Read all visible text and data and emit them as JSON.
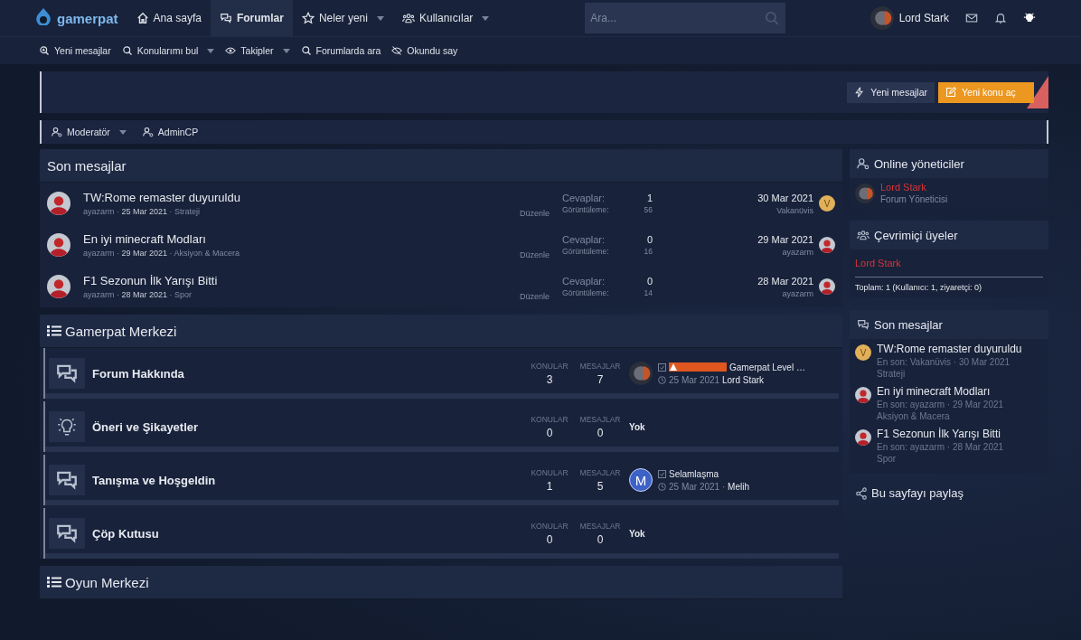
{
  "logo": {
    "text": "gamerpat"
  },
  "nav": [
    {
      "label": "Ana sayfa",
      "selected": false,
      "dropdown": false
    },
    {
      "label": "Forumlar",
      "selected": true,
      "dropdown": false
    },
    {
      "label": "Neler yeni",
      "selected": false,
      "dropdown": true
    },
    {
      "label": "Kullanıcılar",
      "selected": false,
      "dropdown": true
    }
  ],
  "search": {
    "placeholder": "Ara..."
  },
  "user": {
    "name": "Lord Stark"
  },
  "subnav": [
    {
      "label": "Yeni mesajlar",
      "dropdown": false
    },
    {
      "label": "Konularımı bul",
      "dropdown": true
    },
    {
      "label": "Takipler",
      "dropdown": true
    },
    {
      "label": "Forumlarda ara",
      "dropdown": false
    },
    {
      "label": "Okundu say",
      "dropdown": false
    }
  ],
  "actions": [
    {
      "label": "Yeni mesajlar",
      "kind": "secondary"
    },
    {
      "label": "Yeni konu aç",
      "kind": "primary"
    }
  ],
  "staff_bar": [
    {
      "label": "Moderatör",
      "dropdown": true
    },
    {
      "label": "AdminCP",
      "dropdown": false
    }
  ],
  "recent": {
    "title": "Son mesajlar",
    "threads": [
      {
        "title": "TW:Rome remaster duyuruldu",
        "meta": "ayazarm · **25 Mar 2021** · Strateji",
        "edit": "Düzenle",
        "replies_label": "Cevaplar:",
        "replies": "1",
        "views_label": "Görüntüleme:",
        "views": "56",
        "last_date": "30 Mar 2021",
        "last_user": "Vakanüvis",
        "last_avatar": "V"
      },
      {
        "title": "En iyi minecraft Modları",
        "meta": "ayazarm · **29 Mar 2021** · Aksiyon & Macera",
        "edit": "Düzenle",
        "replies_label": "Cevaplar:",
        "replies": "0",
        "views_label": "Görüntüleme:",
        "views": "16",
        "last_date": "29 Mar 2021",
        "last_user": "ayazarm"
      },
      {
        "title": "F1 Sezonun İlk Yarışı Bitti",
        "meta": "ayazarm · **28 Mar 2021** · Spor",
        "edit": "Düzenle",
        "replies_label": "Cevaplar:",
        "replies": "0",
        "views_label": "Görüntüleme:",
        "views": "14",
        "last_date": "28 Mar 2021",
        "last_user": "ayazarm"
      }
    ]
  },
  "categories": [
    {
      "title": "Gamerpat Merkezi",
      "forums": [
        {
          "name": "Forum Hakkında",
          "kind": "discussion",
          "topics_label": "KONULAR",
          "topics": "3",
          "posts_label": "MESAJLAR",
          "posts": "7",
          "last": {
            "kind": "post",
            "prefix": true,
            "title": "Gamerpat Level …",
            "meta": "25 Mar 2021 **Lord Stark**"
          }
        },
        {
          "name": "Öneri ve Şikayetler",
          "kind": "suggestion",
          "topics_label": "KONULAR",
          "topics": "0",
          "posts_label": "MESAJLAR",
          "posts": "0",
          "last": {
            "kind": "none",
            "text": "Yok"
          }
        },
        {
          "name": "Tanışma ve Hoşgeldin",
          "kind": "discussion",
          "topics_label": "KONULAR",
          "topics": "1",
          "posts_label": "MESAJLAR",
          "posts": "5",
          "last": {
            "kind": "post",
            "avatar": "M",
            "prefix": false,
            "title": "Selamlaşma",
            "meta": "25 Mar 2021 · **Melih**"
          }
        },
        {
          "name": "Çöp Kutusu",
          "kind": "discussion",
          "topics_label": "KONULAR",
          "topics": "0",
          "posts_label": "MESAJLAR",
          "posts": "0",
          "last": {
            "kind": "none",
            "text": "Yok"
          }
        }
      ]
    },
    {
      "title": "Oyun Merkezi"
    }
  ],
  "sidebar": {
    "staff": {
      "title": "Online yöneticiler",
      "name": "Lord Stark",
      "role": "Forum Yöneticisi"
    },
    "online": {
      "title": "Çevrimiçi üyeler",
      "members": [
        "Lord Stark"
      ],
      "total": "Toplam: 1 (Kullanıcı: 1, ziyaretçi: 0)"
    },
    "recent": {
      "title": "Son mesajlar",
      "items": [
        {
          "title": "TW:Rome remaster duyuruldu",
          "meta": "En son: Vakanüvis · 30 Mar 2021",
          "forum": "Strateji",
          "avatar": "V"
        },
        {
          "title": "En iyi minecraft Modları",
          "meta": "En son: ayazarm · 29 Mar 2021",
          "forum": "Aksiyon & Macera"
        },
        {
          "title": "F1 Sezonun İlk Yarışı Bitti",
          "meta": "En son: ayazarm · 28 Mar 2021",
          "forum": "Spor"
        }
      ]
    },
    "share": {
      "title": "Bu sayfayı paylaş"
    }
  }
}
